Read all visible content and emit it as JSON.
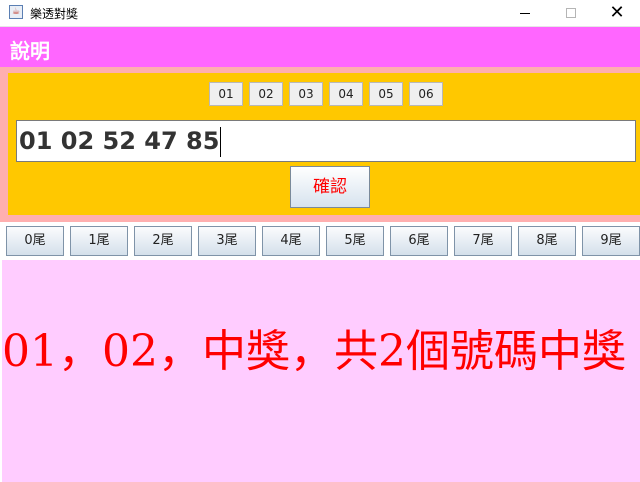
{
  "window": {
    "title": "樂透對獎",
    "icon": "java-app-icon",
    "controls": {
      "minimize": "minimize-icon",
      "maximize": "maximize-icon",
      "close": "✕"
    }
  },
  "header": {
    "title": "說明",
    "background": "#ff66ff"
  },
  "panel": {
    "background": "#ffc800",
    "frame_color": "#ffafaf",
    "chips": [
      "01",
      "02",
      "03",
      "04",
      "05",
      "06"
    ],
    "input_value": "01 02 52 47 85",
    "confirm_label": "確認"
  },
  "tail_buttons": [
    "0尾",
    "1尾",
    "2尾",
    "3尾",
    "4尾",
    "5尾",
    "6尾",
    "7尾",
    "8尾",
    "9尾"
  ],
  "result": {
    "text": "01，02，中獎，共2個號碼中獎",
    "color": "#ff0000",
    "background": "#ffccff"
  }
}
